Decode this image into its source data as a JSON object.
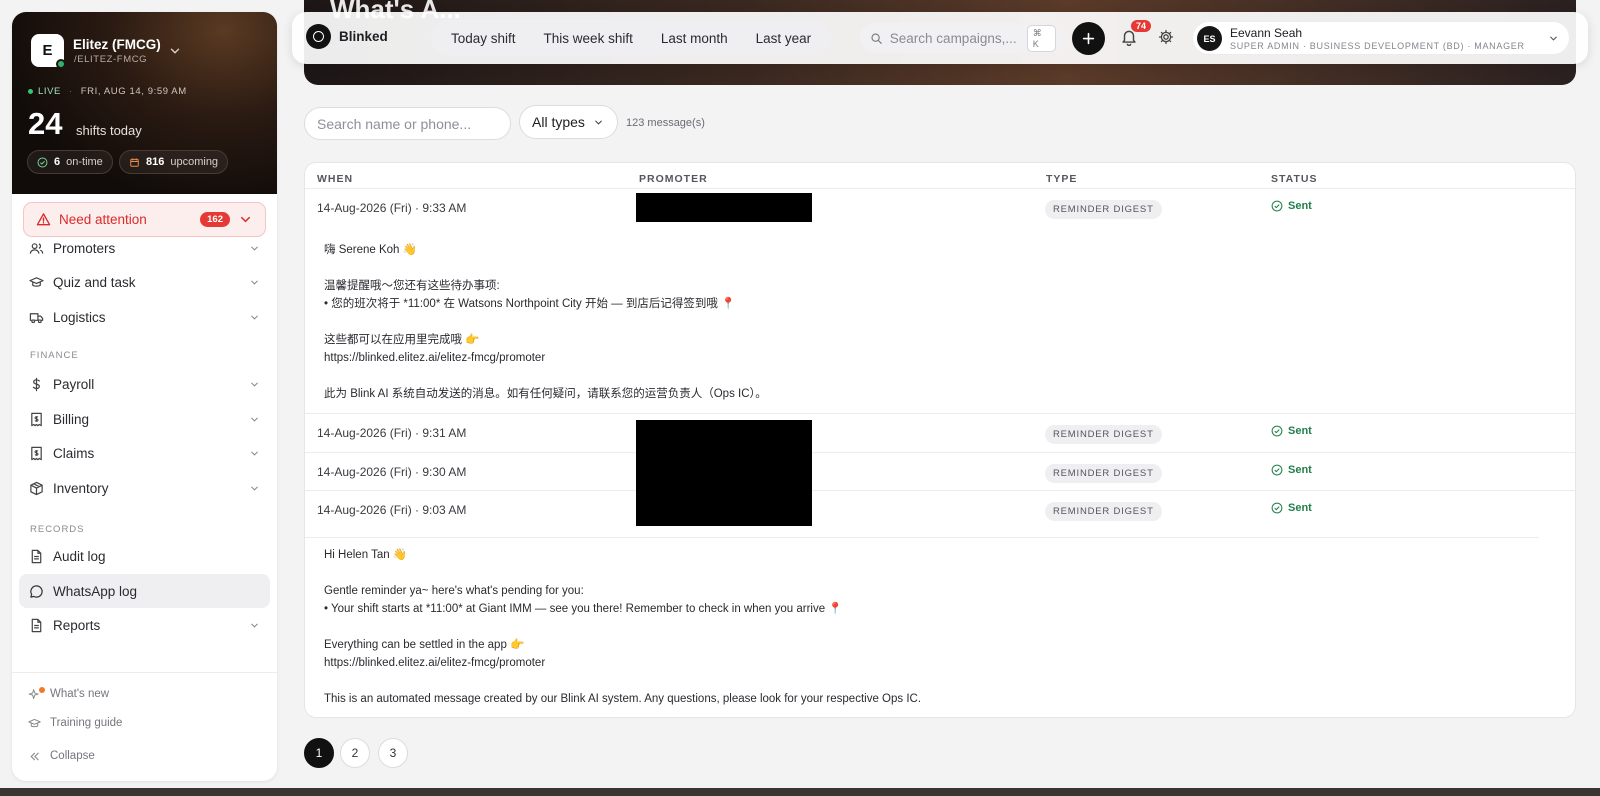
{
  "sidebar": {
    "org": {
      "initial": "E",
      "name": "Elitez (FMCG)",
      "slug": "/ELITEZ-FMCG"
    },
    "live": {
      "label": "LIVE",
      "datetime": "FRI, AUG 14, 9:59 AM"
    },
    "shifts": {
      "count": "24",
      "label": "shifts today"
    },
    "pills": [
      {
        "value": "6",
        "label": "on-time"
      },
      {
        "value": "816",
        "label": "upcoming"
      }
    ],
    "attention": {
      "label": "Need attention",
      "count": "162"
    },
    "nav": [
      {
        "label": "Promoters"
      },
      {
        "label": "Quiz and task"
      },
      {
        "label": "Logistics"
      }
    ],
    "finance_label": "FINANCE",
    "finance": [
      {
        "label": "Payroll"
      },
      {
        "label": "Billing"
      },
      {
        "label": "Claims"
      },
      {
        "label": "Inventory"
      }
    ],
    "records_label": "RECORDS",
    "records": [
      {
        "label": "Audit log"
      },
      {
        "label": "WhatsApp log"
      },
      {
        "label": "Reports"
      }
    ],
    "footer": [
      {
        "label": "What's new"
      },
      {
        "label": "Training guide"
      },
      {
        "label": "Collapse"
      }
    ]
  },
  "banner": {
    "title": "What's A..."
  },
  "topbar": {
    "brand": "Blinked",
    "ranges": [
      "Today shift",
      "This week shift",
      "Last month",
      "Last year"
    ],
    "search_placeholder": "Search campaigns,...",
    "shortcut": "⌘ K",
    "notifications": "74",
    "user": {
      "initials": "ES",
      "name": "Eevann Seah",
      "role": "SUPER ADMIN · BUSINESS DEVELOPMENT (BD) · MANAGER"
    }
  },
  "filters": {
    "search_placeholder": "Search name or phone...",
    "type": "All types",
    "count": "123 message(s)"
  },
  "table": {
    "headers": [
      "WHEN",
      "PROMOTER",
      "TYPE",
      "STATUS"
    ],
    "rows": [
      {
        "when": "14-Aug-2026 (Fri) · 9:33 AM",
        "type": "REMINDER DIGEST",
        "status": "Sent"
      },
      {
        "when": "14-Aug-2026 (Fri) · 9:31 AM",
        "type": "REMINDER DIGEST",
        "status": "Sent"
      },
      {
        "when": "14-Aug-2026 (Fri) · 9:30 AM",
        "type": "REMINDER DIGEST",
        "status": "Sent"
      },
      {
        "when": "14-Aug-2026 (Fri) · 9:03 AM",
        "type": "REMINDER DIGEST",
        "status": "Sent"
      }
    ],
    "message_zh": [
      "嗨 Serene Koh 👋",
      "",
      "温馨提醒哦～您还有这些待办事项:",
      "• 您的班次将于 *11:00* 在 Watsons Northpoint City 开始 — 到店后记得签到哦 📍",
      "",
      "这些都可以在应用里完成哦 👉",
      "https://blinked.elitez.ai/elitez-fmcg/promoter",
      "",
      "此为 Blink AI 系统自动发送的消息。如有任何疑问，请联系您的运营负责人（Ops IC）。"
    ],
    "message_en": [
      "Hi Helen Tan 👋",
      "",
      "Gentle reminder ya~ here's what's pending for you:",
      "• Your shift starts at *11:00* at Giant IMM — see you there! Remember to check in when you arrive 📍",
      "",
      "Everything can be settled in the app 👉",
      "https://blinked.elitez.ai/elitez-fmcg/promoter",
      "",
      "This is an automated message created by our Blink AI system. Any questions, please look for your respective Ops IC."
    ]
  },
  "pagination": [
    "1",
    "2",
    "3"
  ]
}
